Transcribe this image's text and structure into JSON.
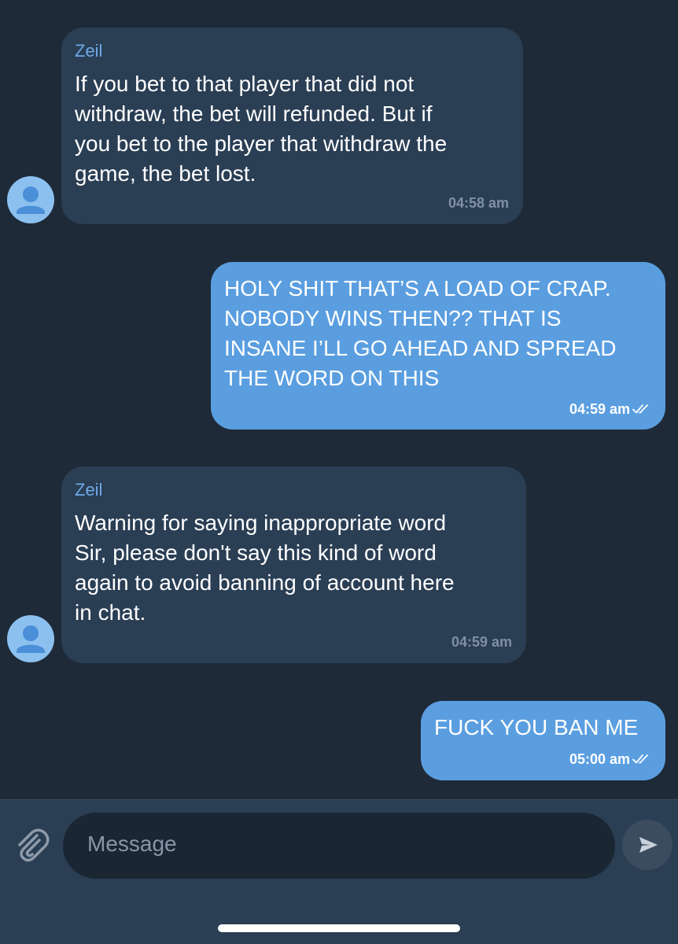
{
  "messages": [
    {
      "direction": "incoming",
      "sender": "Zeil",
      "text": "If you bet to that player that did not\nwithdraw, the bet will refunded. But if\nyou bet to the player that withdraw the\ngame, the bet lost.",
      "time": "04:58 am"
    },
    {
      "direction": "outgoing",
      "text": "HOLY SHIT THAT’S A LOAD OF CRAP.\nNOBODY WINS THEN?? THAT IS\nINSANE I’LL GO AHEAD AND SPREAD\nTHE WORD ON THIS",
      "time": "04:59 am",
      "status_icon": "double-check-icon"
    },
    {
      "direction": "incoming",
      "sender": "Zeil",
      "text": "Warning for saying inappropriate word\nSir, please don't say this kind of word\nagain to avoid banning of account here\nin chat.",
      "time": "04:59 am"
    },
    {
      "direction": "outgoing",
      "text": "FUCK YOU BAN ME",
      "time": "05:00 am",
      "status_icon": "double-check-icon"
    }
  ],
  "composer": {
    "placeholder": "Message",
    "attach_icon": "paperclip-icon",
    "send_icon": "send-icon"
  },
  "colors": {
    "background": "#1e2a37",
    "incoming_bubble": "#2a3e54",
    "outgoing_bubble": "#5a9ee0",
    "sender_name": "#6fa9e6",
    "avatar": "#8cc0ef"
  }
}
